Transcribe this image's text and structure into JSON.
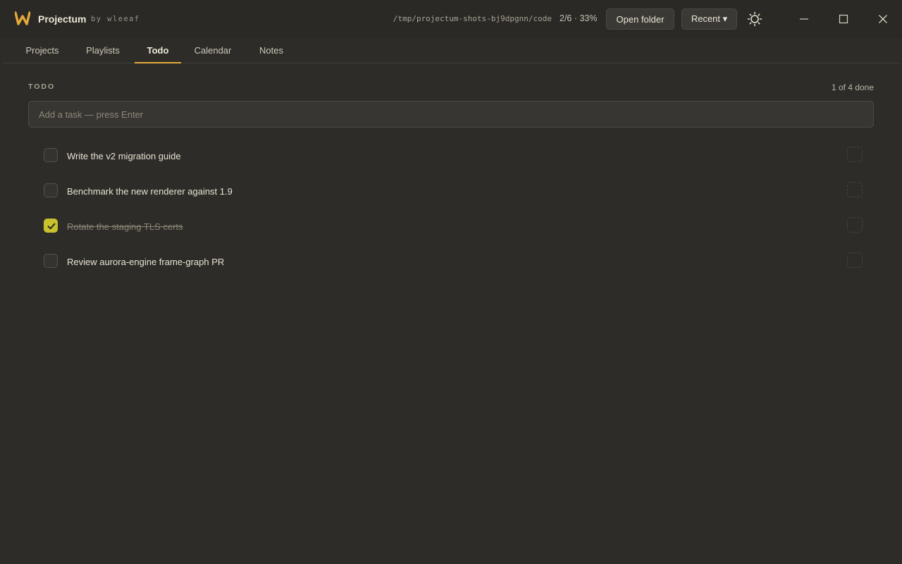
{
  "app": {
    "name": "Projectum",
    "byline": "by wleeaf",
    "logo_icon": "w-logo-icon",
    "accent_color": "#e7a93a"
  },
  "header": {
    "path": "/tmp/projectum-shots-bj9dpgnn/code",
    "progress": "2/6 · 33%",
    "open_folder_label": "Open folder",
    "recent_label": "Recent ▾",
    "theme_icon": "sun-icon"
  },
  "tabs": [
    {
      "label": "Projects",
      "active": false
    },
    {
      "label": "Playlists",
      "active": false
    },
    {
      "label": "Todo",
      "active": true
    },
    {
      "label": "Calendar",
      "active": false
    },
    {
      "label": "Notes",
      "active": false
    }
  ],
  "todo": {
    "section_label": "TODO",
    "done_count": "1 of 4 done",
    "input_placeholder": "Add a task — press Enter",
    "input_value": "",
    "items": [
      {
        "text": "Write the v2 migration guide",
        "done": false
      },
      {
        "text": "Benchmark the new renderer against 1.9",
        "done": false
      },
      {
        "text": "Rotate the staging TLS certs",
        "done": true
      },
      {
        "text": "Review aurora-engine frame-graph PR",
        "done": false
      }
    ],
    "check_color": "#c8c22c"
  }
}
